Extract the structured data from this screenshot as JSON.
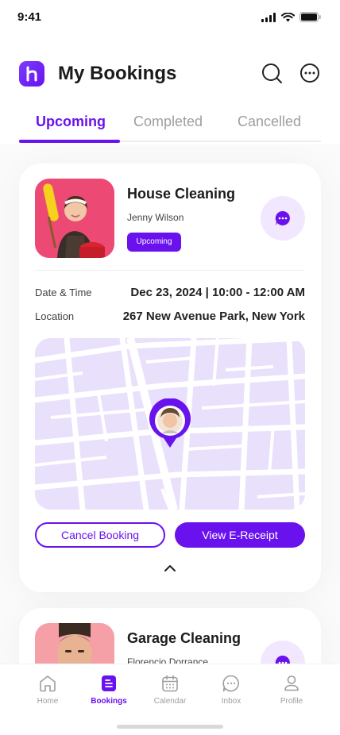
{
  "status_bar": {
    "time": "9:41"
  },
  "header": {
    "title": "My Bookings"
  },
  "tabs": [
    {
      "label": "Upcoming",
      "active": true
    },
    {
      "label": "Completed",
      "active": false
    },
    {
      "label": "Cancelled",
      "active": false
    }
  ],
  "bookings": [
    {
      "service": "House Cleaning",
      "provider": "Jenny Wilson",
      "status": "Upcoming",
      "date_time_label": "Date & Time",
      "date_time": "Dec 23, 2024 | 10:00 - 12:00 AM",
      "location_label": "Location",
      "location": "267 New Avenue Park, New York",
      "cancel_label": "Cancel Booking",
      "receipt_label": "View E-Receipt"
    },
    {
      "service": "Garage Cleaning",
      "provider": "Florencio Dorrance"
    }
  ],
  "bottom_nav": [
    {
      "label": "Home",
      "icon": "home-icon",
      "active": false
    },
    {
      "label": "Bookings",
      "icon": "bookings-icon",
      "active": true
    },
    {
      "label": "Calendar",
      "icon": "calendar-icon",
      "active": false
    },
    {
      "label": "Inbox",
      "icon": "inbox-icon",
      "active": false
    },
    {
      "label": "Profile",
      "icon": "profile-icon",
      "active": false
    }
  ],
  "colors": {
    "accent": "#6A12EE",
    "accent_light": "#F1E8FF",
    "map_bg": "#E9E0FB",
    "text_primary": "#212121",
    "text_muted": "#9E9E9E"
  }
}
